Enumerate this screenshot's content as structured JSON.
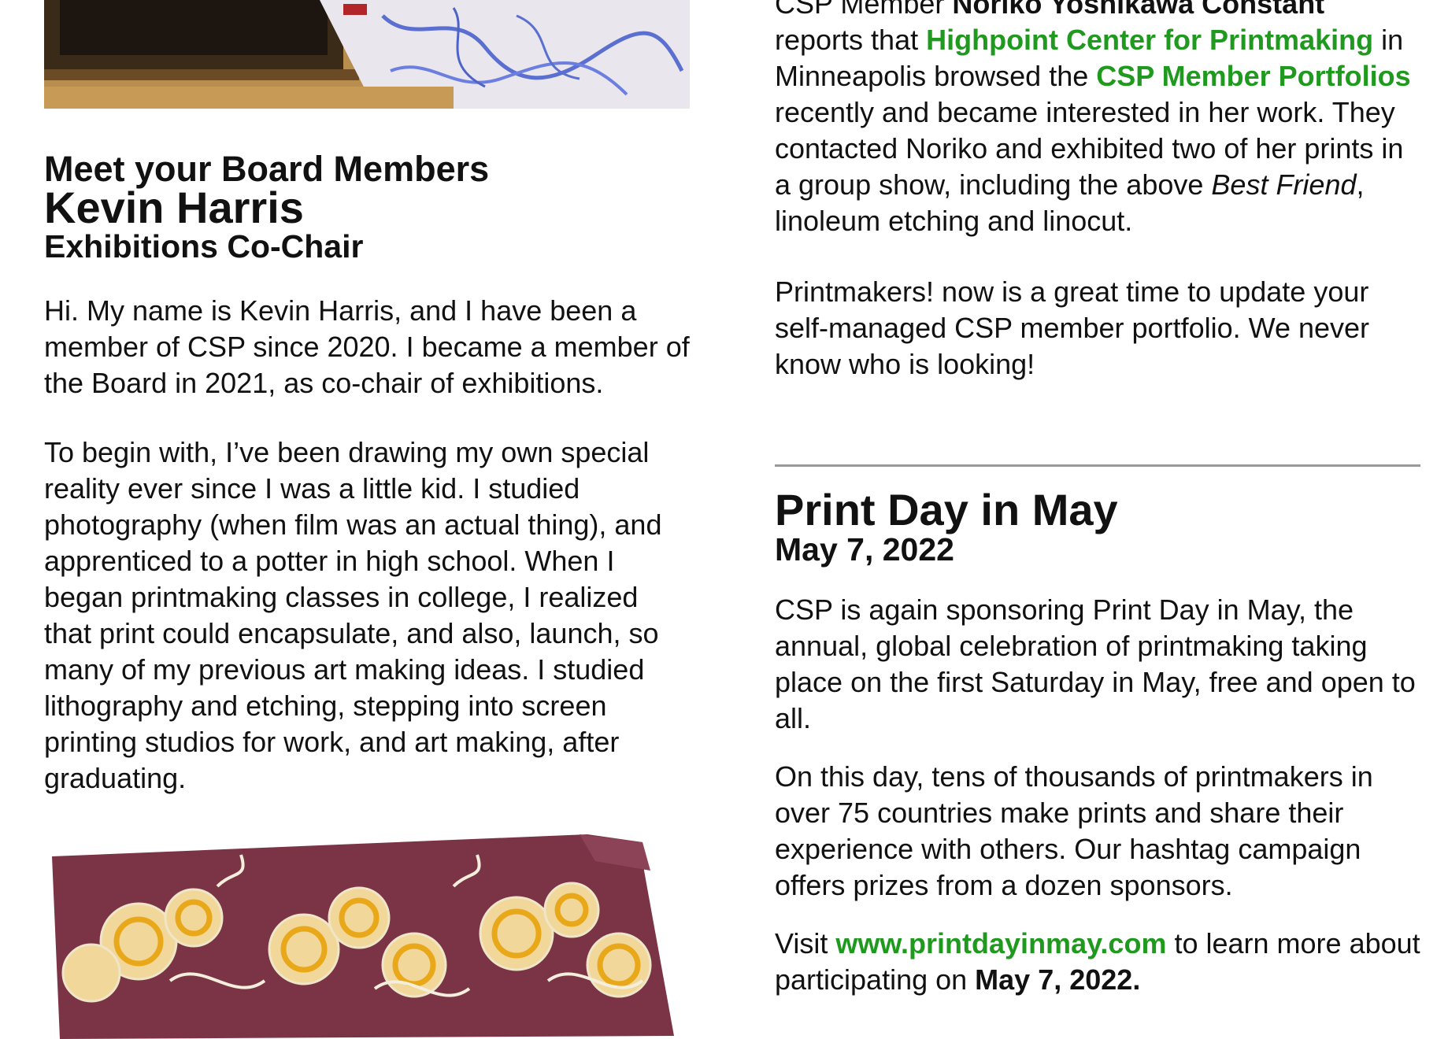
{
  "left": {
    "heading_sub": "Meet your Board Members",
    "heading_name": "Kevin Harris",
    "heading_role": "Exhibitions Co-Chair",
    "para1": "Hi. My name is Kevin Harris, and I have been a member of CSP since 2020. I became a member of the Board in 2021, as co-chair of exhibitions.",
    "para2": "To begin with, I’ve been drawing my own special reality ever since I was a little kid. I studied photography (when film was an actual thing), and apprenticed to a potter in high school. When I began printmaking classes in college, I realized that print could encapsulate, and also, launch, so many of my previous art making ideas. I studied lithography and etching, stepping into screen printing studios for work, and art making, after graduating."
  },
  "right": {
    "p1_a": "CSP Member ",
    "p1_member": "Noriko Yoshikawa Constant",
    "p1_b": " reports that ",
    "p1_link1": "Highpoint Center for Printmaking",
    "p1_c": " in Minneapolis browsed the ",
    "p1_link2": "CSP Member Portfolios",
    "p1_d": " recently and became interested in her work. They contacted Noriko and exhibited two of her prints in a group show, including the above ",
    "p1_title": "Best Friend",
    "p1_e": ", linoleum etching and linocut.",
    "p2": "Printmakers! now is a great time to update your self-managed CSP member portfolio. We never know who is looking!",
    "section_title": "Print Day in May",
    "section_date": "May 7, 2022",
    "p3": "CSP is again sponsoring Print Day in May, the annual, global celebration of printmaking taking place on the first Saturday in May, free and open to all.",
    "p4": "On this day, tens of thousands of printmakers in over 75 countries make prints and share their experience with others. Our hashtag campaign offers prizes from a dozen sponsors.",
    "p5_a": "Visit ",
    "p5_link": "www.printdayinmay.com",
    "p5_b": " to learn more about participating on ",
    "p5_date": "May 7, 2022."
  },
  "colors": {
    "link": "#1f9a1f",
    "rule": "#9a9a9a"
  }
}
